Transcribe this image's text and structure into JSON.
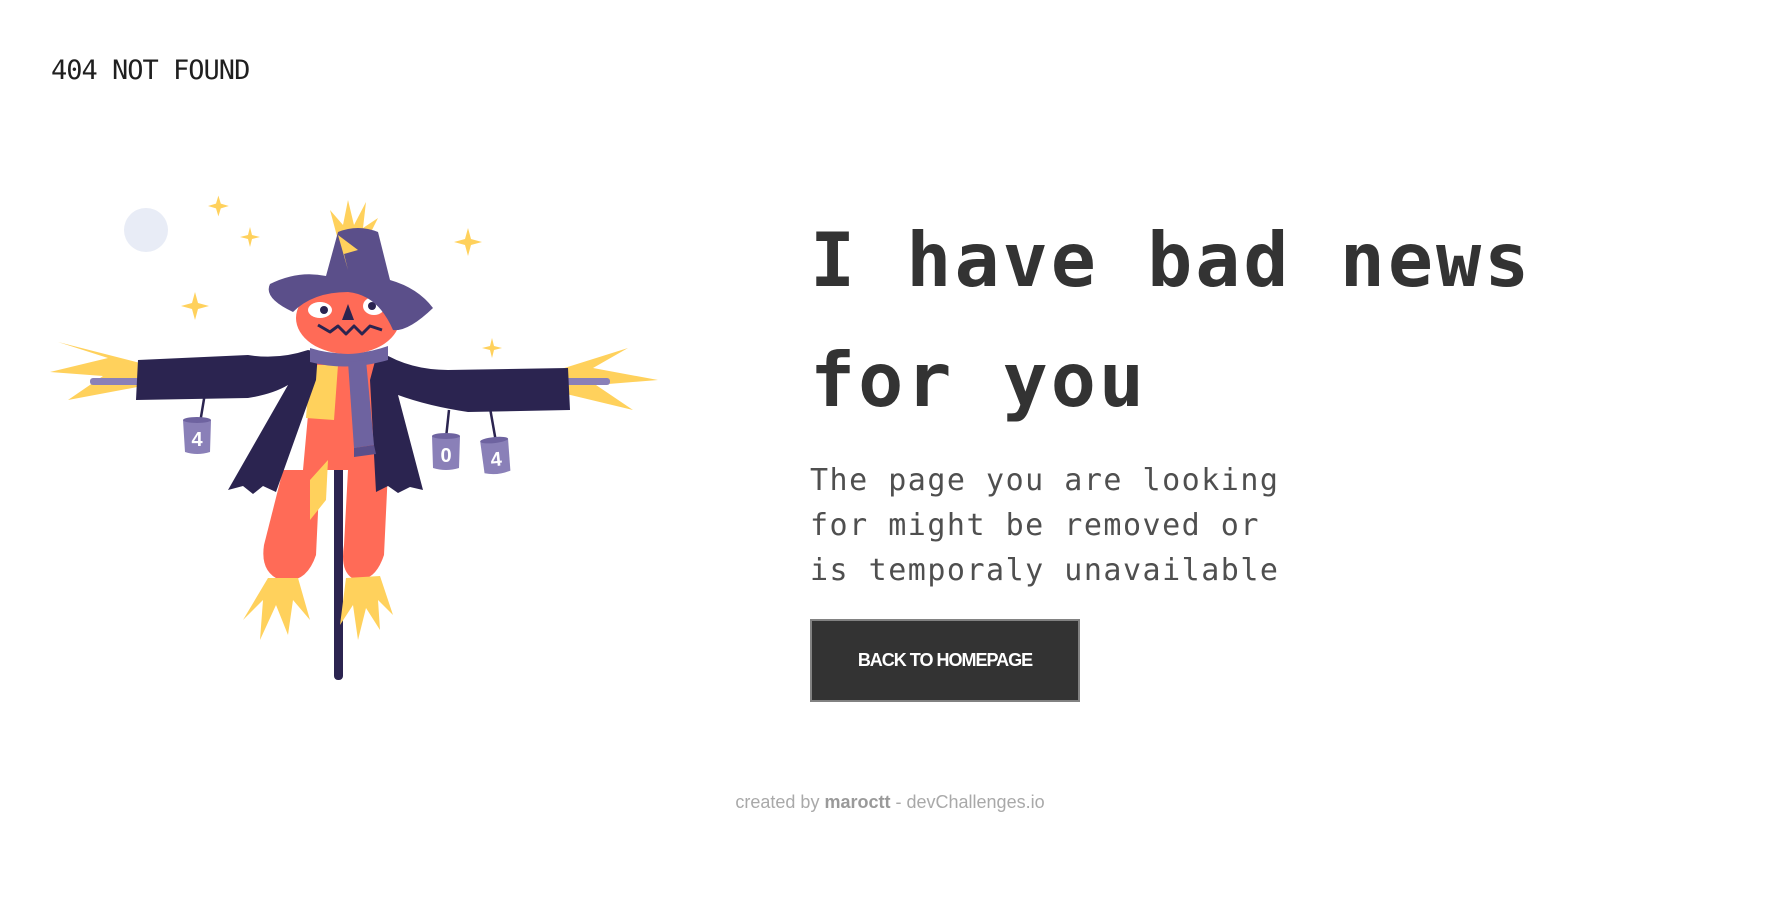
{
  "header": {
    "brand": "404 NOT FOUND"
  },
  "main": {
    "headline_line1": "I have bad news",
    "headline_line2": "for you",
    "subtext_line1": "The page you are looking",
    "subtext_line2": "for might be removed or",
    "subtext_line3": "is temporaly unavailable",
    "cta_label": "BACK TO HOMEPAGE"
  },
  "illustration": {
    "subject": "scarecrow-illustration",
    "can_labels": [
      "4",
      "0",
      "4"
    ]
  },
  "footer": {
    "prefix": "created by",
    "author": "maroctt",
    "suffix": "- devChallenges.io"
  },
  "colors": {
    "text_dark": "#333333",
    "button_bg": "#333333",
    "button_border": "#828282",
    "footer_text": "#A9A9A9",
    "scarecrow_coat": "#2B2450",
    "scarecrow_hat": "#5B4F8A",
    "scarecrow_face": "#FF6B57",
    "straw": "#FFD15C",
    "moon": "#E8ECF6"
  }
}
